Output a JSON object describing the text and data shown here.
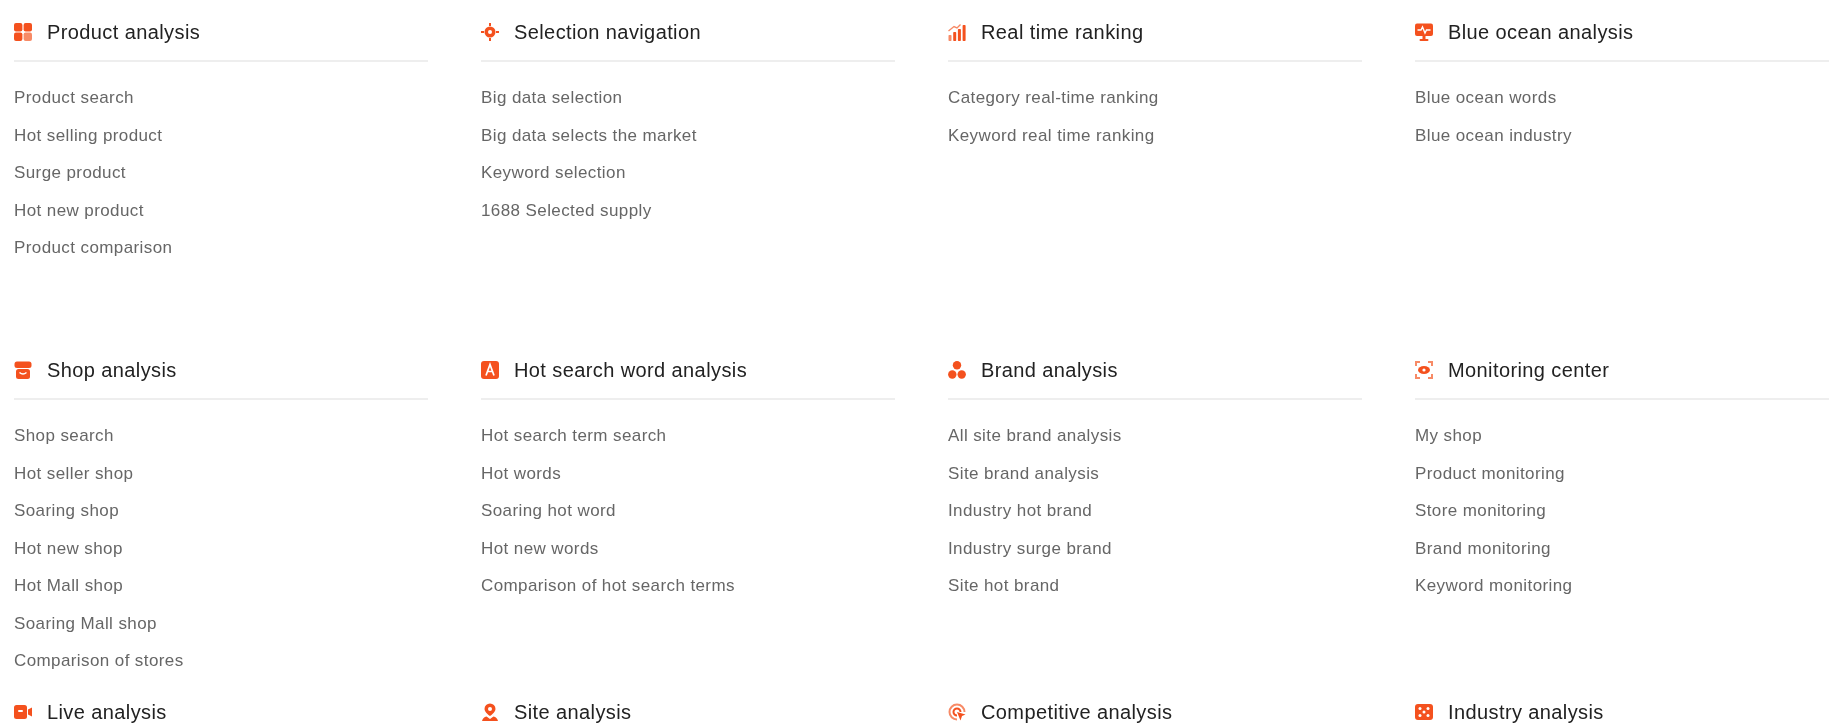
{
  "sections": [
    {
      "title": "Product analysis",
      "items": [
        "Product search",
        "Hot selling product",
        "Surge product",
        "Hot new product",
        "Product comparison"
      ]
    },
    {
      "title": "Selection navigation",
      "items": [
        "Big data selection",
        "Big data selects the market",
        "Keyword selection",
        "1688 Selected supply"
      ]
    },
    {
      "title": "Real time ranking",
      "items": [
        "Category real-time ranking",
        "Keyword real time ranking"
      ]
    },
    {
      "title": "Blue ocean analysis",
      "items": [
        "Blue ocean words",
        "Blue ocean industry"
      ]
    },
    {
      "title": "Shop analysis",
      "items": [
        "Shop search",
        "Hot seller shop",
        "Soaring shop",
        "Hot new shop",
        "Hot Mall shop",
        "Soaring Mall shop",
        "Comparison of stores"
      ]
    },
    {
      "title": "Hot search word analysis",
      "items": [
        "Hot search term search",
        "Hot words",
        "Soaring hot word",
        "Hot new words",
        "Comparison of hot search terms"
      ]
    },
    {
      "title": "Brand analysis",
      "items": [
        "All site brand analysis",
        "Site brand analysis",
        "Industry hot brand",
        "Industry surge brand",
        "Site hot brand"
      ]
    },
    {
      "title": "Monitoring center",
      "items": [
        "My shop",
        "Product monitoring",
        "Store monitoring",
        "Brand monitoring",
        "Keyword monitoring"
      ]
    },
    {
      "title": "Live analysis"
    },
    {
      "title": "Site analysis"
    },
    {
      "title": "Competitive analysis"
    },
    {
      "title": "Industry analysis"
    }
  ]
}
